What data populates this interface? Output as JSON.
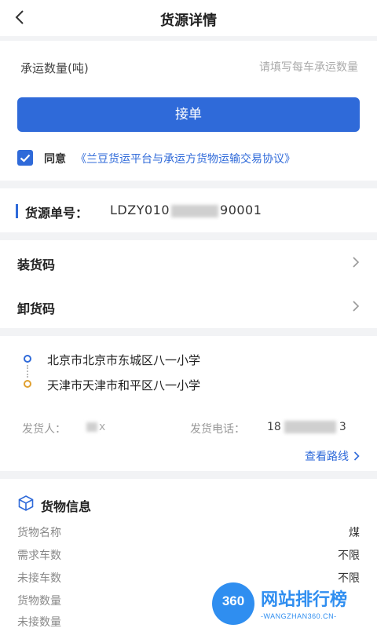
{
  "header": {
    "title": "货源详情",
    "back_icon": "chevron-left-icon"
  },
  "quantity": {
    "label": "承运数量(吨)",
    "placeholder": "请填写每车承运数量",
    "value": ""
  },
  "accept_button": "接单",
  "agreement": {
    "checked": true,
    "prefix": "同意",
    "link": "《兰豆货运平台与承运方货物运输交易协议》"
  },
  "order": {
    "label": "货源单号：",
    "number_prefix": "LDZY010",
    "number_suffix": "90001"
  },
  "codes": [
    {
      "label": "装货码"
    },
    {
      "label": "卸货码"
    }
  ],
  "route": {
    "origin": "北京市北京市东城区八一小学",
    "destination": "天津市天津市和平区八一小学",
    "shipper_label": "发货人：",
    "shipper_name_visible": "x",
    "phone_label": "发货电话：",
    "phone_prefix": "18",
    "phone_suffix": "3",
    "view_route": "查看路线"
  },
  "cargo": {
    "title": "货物信息",
    "rows": [
      {
        "label": "货物名称",
        "value": "煤"
      },
      {
        "label": "需求车数",
        "value": "不限"
      },
      {
        "label": "未接车数",
        "value": "不限"
      },
      {
        "label": "货物数量",
        "value": ""
      },
      {
        "label": "未接数量",
        "value": ""
      }
    ]
  },
  "watermark": {
    "badge": "360",
    "title": "网站排行榜",
    "subtitle": "-WANGZHAN360.CN-"
  },
  "colors": {
    "accent": "#2f6ad9",
    "origin_dot": "#2f6ad9",
    "destination_dot": "#e0a030",
    "watermark": "#2f8ef0"
  }
}
